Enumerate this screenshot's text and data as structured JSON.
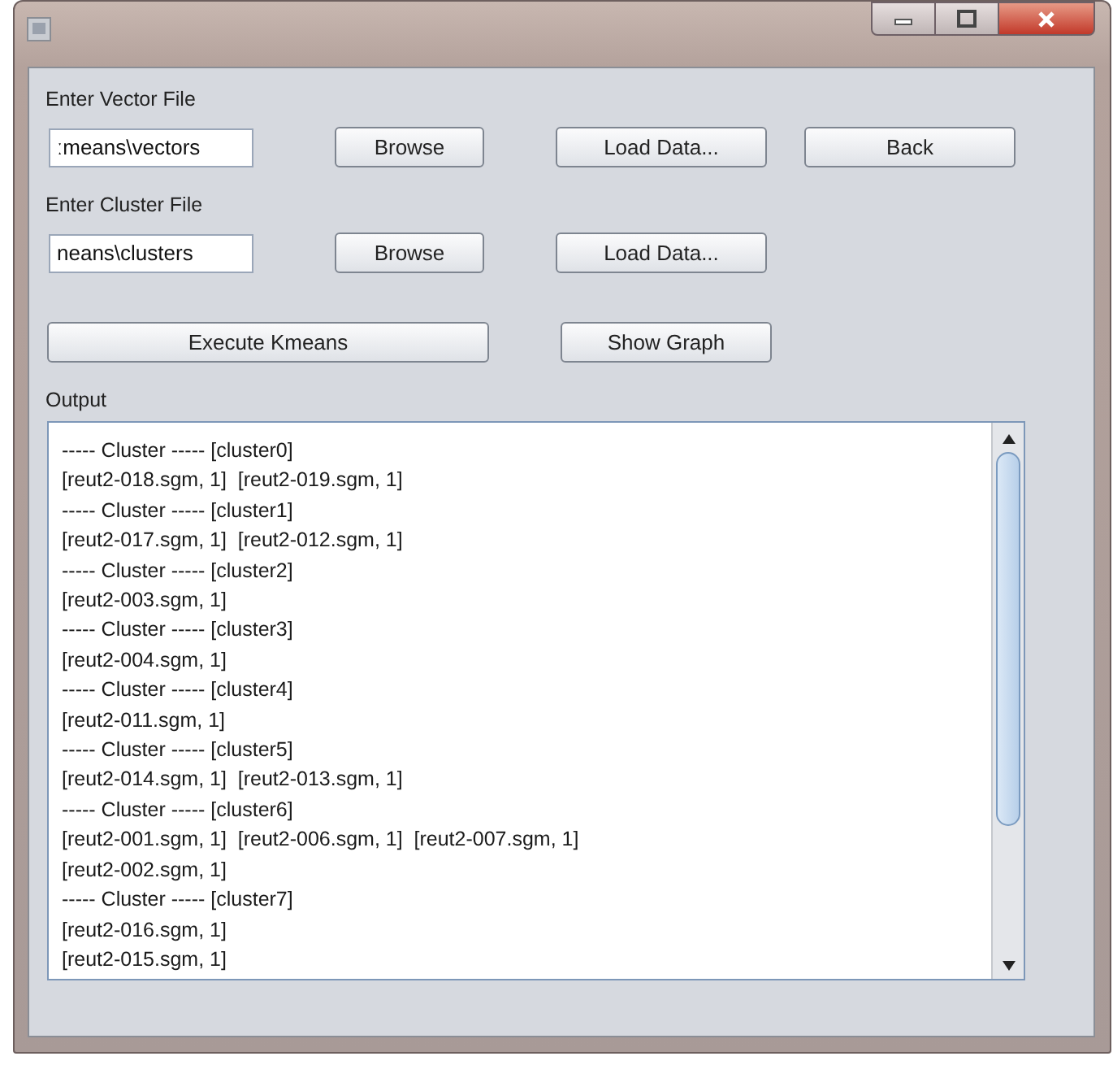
{
  "rows": [
    {
      "label": "Enter Vector File",
      "field": {
        "value": "ːmeans\\vectors"
      },
      "buttons": [
        {
          "label": "Browse"
        },
        {
          "label": "Load Data..."
        },
        {
          "label": "Back"
        }
      ]
    },
    {
      "label": "Enter Cluster File",
      "field": {
        "value": "neans\\clusters"
      },
      "buttons": [
        {
          "label": "Browse"
        },
        {
          "label": "Load Data..."
        }
      ]
    }
  ],
  "actions": [
    {
      "label": "Execute Kmeans"
    },
    {
      "label": "Show Graph"
    }
  ],
  "output": {
    "label": "Output",
    "lines": [
      "----- Cluster ----- [cluster0]",
      "[reut2-018.sgm, 1]  [reut2-019.sgm, 1]",
      "----- Cluster ----- [cluster1]",
      "[reut2-017.sgm, 1]  [reut2-012.sgm, 1]",
      "----- Cluster ----- [cluster2]",
      "[reut2-003.sgm, 1]",
      "----- Cluster ----- [cluster3]",
      "[reut2-004.sgm, 1]",
      "----- Cluster ----- [cluster4]",
      "[reut2-011.sgm, 1]",
      "----- Cluster ----- [cluster5]",
      "[reut2-014.sgm, 1]  [reut2-013.sgm, 1]",
      "----- Cluster ----- [cluster6]",
      "[reut2-001.sgm, 1]  [reut2-006.sgm, 1]  [reut2-007.sgm, 1]",
      "[reut2-002.sgm, 1]",
      "----- Cluster ----- [cluster7]",
      "[reut2-016.sgm, 1]",
      "[reut2-015.sgm, 1]"
    ]
  }
}
